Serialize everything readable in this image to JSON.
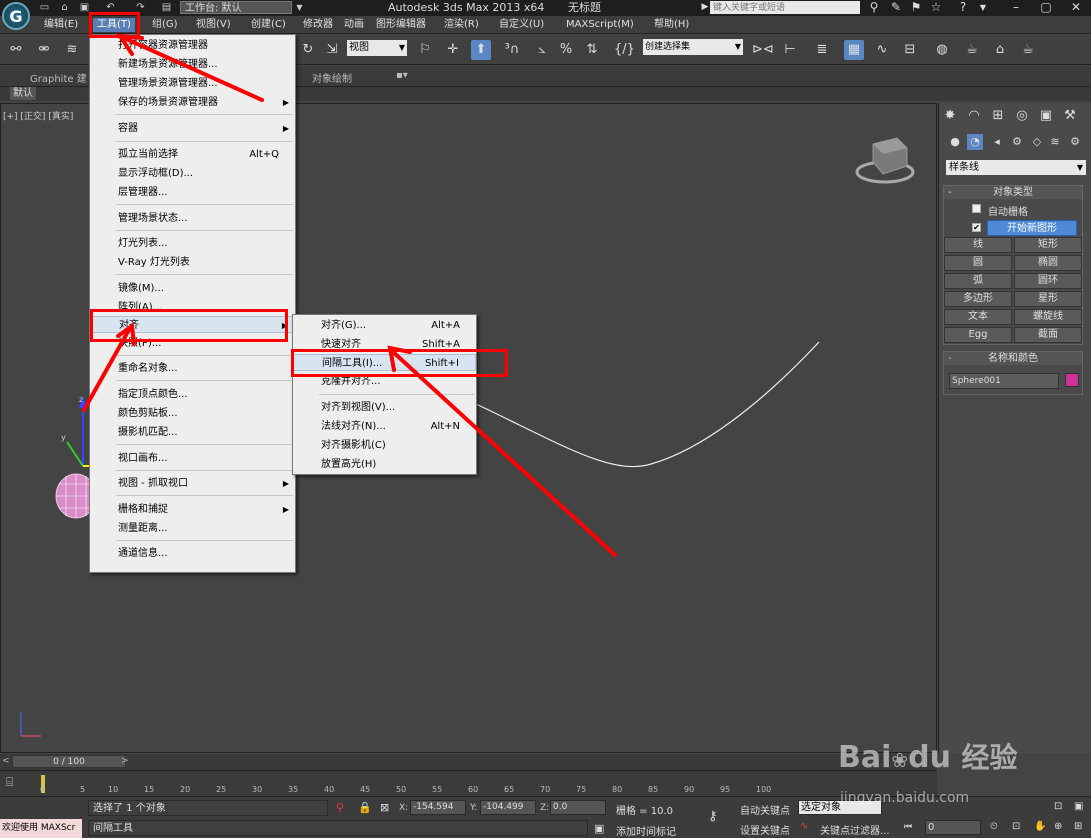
{
  "title_bar": {
    "logo_letter": "G",
    "workspace": "工作台: 默认",
    "app_title": "Autodesk 3ds Max  2013 x64",
    "doc_name": "无标题",
    "search_placeholder": "键入关键字或短语"
  },
  "menubar": {
    "items": [
      "编辑(E)",
      "工具(T)",
      "组(G)",
      "视图(V)",
      "创建(C)",
      "修改器",
      "动画",
      "图形编辑器",
      "渲染(R)",
      "自定义(U)",
      "MAXScript(M)",
      "帮助(H)"
    ]
  },
  "toolbar": {
    "view_dropdown": "视图",
    "selection_set": "创建选择集"
  },
  "ribbon": {
    "graphite": "Graphite 建",
    "obj_paint": "对象绘制",
    "default_tab": "默认"
  },
  "viewport": {
    "label": "[+] [正交] [真实]"
  },
  "tools_menu": {
    "items": [
      {
        "label": "打开容器资源管理器",
        "shortcut": "",
        "sub": false
      },
      {
        "label": "新建场景资源管理器...",
        "shortcut": "",
        "sub": false
      },
      {
        "label": "管理场景资源管理器...",
        "shortcut": "",
        "sub": false
      },
      {
        "label": "保存的场景资源管理器",
        "shortcut": "",
        "sub": true
      },
      {
        "label": "容器",
        "shortcut": "",
        "sub": true
      },
      {
        "label": "孤立当前选择",
        "shortcut": "Alt+Q",
        "sub": false
      },
      {
        "label": "显示浮动框(D)...",
        "shortcut": "",
        "sub": false
      },
      {
        "label": "层管理器...",
        "shortcut": "",
        "sub": false
      },
      {
        "label": "管理场景状态...",
        "shortcut": "",
        "sub": false
      },
      {
        "label": "灯光列表...",
        "shortcut": "",
        "sub": false
      },
      {
        "label": "V-Ray 灯光列表",
        "shortcut": "",
        "sub": false
      },
      {
        "label": "镜像(M)...",
        "shortcut": "",
        "sub": false
      },
      {
        "label": "阵列(A)...",
        "shortcut": "",
        "sub": false
      },
      {
        "label": "对齐",
        "shortcut": "",
        "sub": true
      },
      {
        "label": "快照(P)...",
        "shortcut": "",
        "sub": false
      },
      {
        "label": "重命名对象...",
        "shortcut": "",
        "sub": false
      },
      {
        "label": "指定顶点颜色...",
        "shortcut": "",
        "sub": false
      },
      {
        "label": "颜色剪贴板...",
        "shortcut": "",
        "sub": false
      },
      {
        "label": "摄影机匹配...",
        "shortcut": "",
        "sub": false
      },
      {
        "label": "视口画布...",
        "shortcut": "",
        "sub": false
      },
      {
        "label": "视图 - 抓取视口",
        "shortcut": "",
        "sub": true
      },
      {
        "label": "栅格和捕捉",
        "shortcut": "",
        "sub": true
      },
      {
        "label": "测量距离...",
        "shortcut": "",
        "sub": false
      },
      {
        "label": "通道信息...",
        "shortcut": "",
        "sub": false
      }
    ]
  },
  "align_menu": {
    "items": [
      {
        "label": "对齐(G)...",
        "shortcut": "Alt+A"
      },
      {
        "label": "快速对齐",
        "shortcut": "Shift+A"
      },
      {
        "label": "间隔工具(I)...",
        "shortcut": "Shift+I"
      },
      {
        "label": "克隆并对齐...",
        "shortcut": ""
      },
      {
        "label": "对齐到视图(V)...",
        "shortcut": ""
      },
      {
        "label": "法线对齐(N)...",
        "shortcut": "Alt+N"
      },
      {
        "label": "对齐摄影机(C)",
        "shortcut": ""
      },
      {
        "label": "放置高光(H)",
        "shortcut": ""
      }
    ]
  },
  "command_panel": {
    "shape_type": "样条线",
    "object_type_title": "对象类型",
    "auto_grid": "自动栅格",
    "start_new_shape": "开始新图形",
    "shapes": [
      "线",
      "矩形",
      "圆",
      "椭圆",
      "弧",
      "圆环",
      "多边形",
      "星形",
      "文本",
      "螺旋线",
      "Egg",
      "截面"
    ],
    "name_color_title": "名称和颜色",
    "object_name": "Sphere001",
    "object_color": "#cc3399"
  },
  "timeline": {
    "frame": "0 / 100",
    "ticks": [
      "0",
      "5",
      "10",
      "15",
      "20",
      "25",
      "30",
      "35",
      "40",
      "45",
      "50",
      "55",
      "60",
      "65",
      "70",
      "75",
      "80",
      "85",
      "90",
      "95",
      "100"
    ]
  },
  "status": {
    "welcome": "欢迎使用 MAXScr",
    "selection": "选择了 1 个对象",
    "prompt": "间隔工具",
    "x_label": "X:",
    "x": "-154.594",
    "y_label": "Y:",
    "y": "-104.499",
    "z_label": "Z:",
    "z": "0.0",
    "grid": "栅格 = 10.0",
    "add_time_tag": "添加时间标记",
    "auto_key": "自动关键点",
    "selected_obj": "选定对象",
    "set_key": "设置关键点",
    "key_filters": "关键点过滤器...",
    "frame_field": "0"
  },
  "watermark": {
    "brand": "Bai",
    "brand_du": "du",
    "jingyan": "经验",
    "url": "jingyan.baidu.com"
  }
}
